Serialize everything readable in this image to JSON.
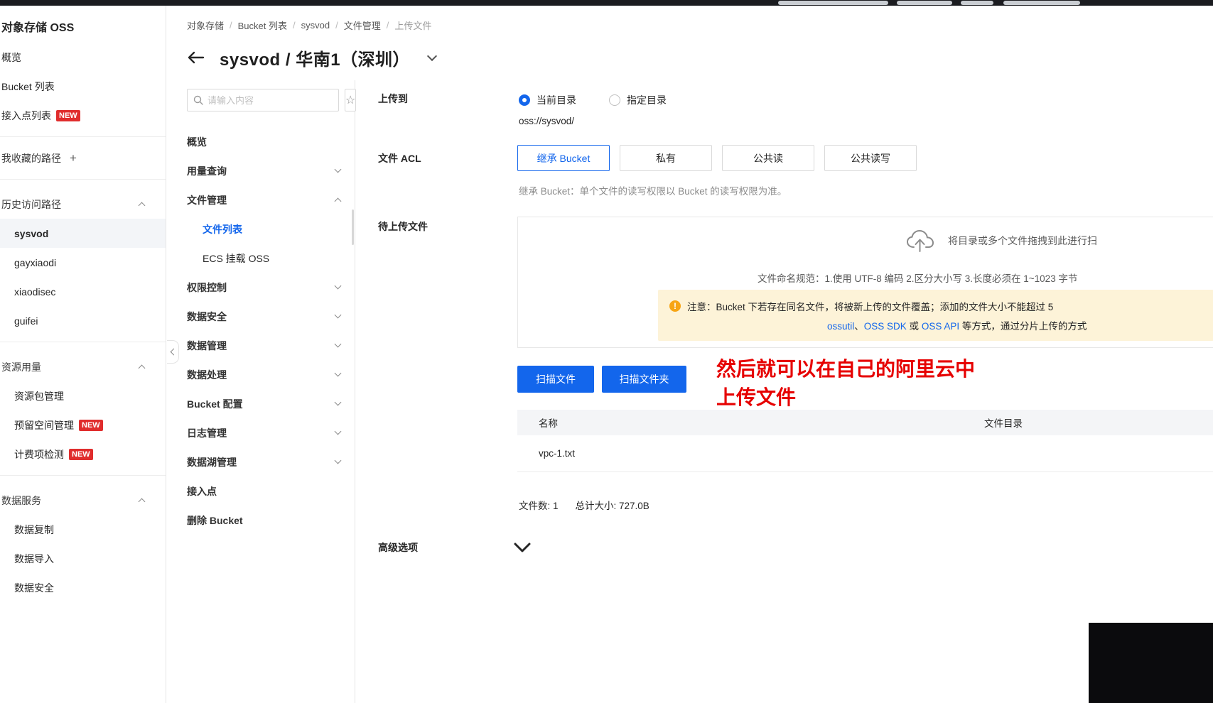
{
  "colors": {
    "accent": "#1366ec",
    "link": "#1366ec",
    "badge_red": "#e02d2d",
    "warning_bg": "#fdf3d8",
    "warning_icon": "#f7a514",
    "annotation_red": "#e60000"
  },
  "icons": {
    "star": "☆",
    "plus": "+",
    "warning": "!"
  },
  "left_sidebar": {
    "title": "对象存储 OSS",
    "items_top": [
      {
        "label": "概览"
      },
      {
        "label": "Bucket 列表"
      },
      {
        "label": "接入点列表",
        "badge": "NEW"
      }
    ],
    "favorites": {
      "label": "我收藏的路径",
      "action": "+"
    },
    "history": {
      "label": "历史访问路径",
      "items": [
        "sysvod",
        "gayxiaodi",
        "xiaodisec",
        "guifei"
      ]
    },
    "resources": {
      "label": "资源用量",
      "items": [
        {
          "label": "资源包管理"
        },
        {
          "label": "预留空间管理",
          "badge": "NEW"
        },
        {
          "label": "计费项检测",
          "badge": "NEW"
        }
      ]
    },
    "services": {
      "label": "数据服务",
      "items": [
        {
          "label": "数据复制"
        },
        {
          "label": "数据导入"
        },
        {
          "label": "数据安全"
        }
      ]
    }
  },
  "header": {
    "breadcrumb": [
      "对象存储",
      "Bucket 列表",
      "sysvod",
      "文件管理",
      "上传文件"
    ],
    "title": "sysvod / 华南1（深圳）"
  },
  "nav": {
    "search_placeholder": "请输入内容",
    "items": [
      {
        "label": "概览"
      },
      {
        "label": "用量查询"
      },
      {
        "label": "文件管理"
      },
      {
        "label": "文件列表"
      },
      {
        "label": "ECS 挂载 OSS"
      },
      {
        "label": "权限控制"
      },
      {
        "label": "数据安全"
      },
      {
        "label": "数据管理"
      },
      {
        "label": "数据处理"
      },
      {
        "label": "Bucket 配置"
      },
      {
        "label": "日志管理"
      },
      {
        "label": "数据湖管理"
      },
      {
        "label": "接入点"
      },
      {
        "label": "删除 Bucket"
      }
    ]
  },
  "form": {
    "upload_to": {
      "label": "上传到",
      "options": [
        "当前目录",
        "指定目录"
      ],
      "path": "oss://sysvod/"
    },
    "acl": {
      "label": "文件 ACL",
      "options": [
        "继承 Bucket",
        "私有",
        "公共读",
        "公共读写"
      ],
      "note": "继承 Bucket：单个文件的读写权限以 Bucket 的读写权限为准。"
    },
    "pending": {
      "label": "待上传文件",
      "drop_hint": "将目录或多个文件拖拽到此进行扫",
      "naming_rule": "文件命名规范：1.使用 UTF-8 编码 2.区分大小写 3.长度必须在 1~1023 字节",
      "warning": {
        "line1": "注意：Bucket 下若存在同名文件，将被新上传的文件覆盖；添加的文件大小不能超过 5",
        "link1": "ossutil",
        "sep1": "、",
        "link2": "OSS SDK",
        "sep2": " 或 ",
        "link3": "OSS API",
        "tail": " 等方式，通过分片上传的方式"
      },
      "scan_file": "扫描文件",
      "scan_folder": "扫描文件夹",
      "table": {
        "headers": [
          "名称",
          "文件目录"
        ],
        "rows": [
          {
            "name": "vpc-1.txt",
            "dir": ""
          }
        ]
      },
      "summary_files": "文件数: 1",
      "summary_size": "总计大小: 727.0B"
    },
    "advanced": {
      "label": "高级选项"
    }
  },
  "annotation": {
    "line1": "然后就可以在自己的阿里云中",
    "line2": "上传文件"
  }
}
